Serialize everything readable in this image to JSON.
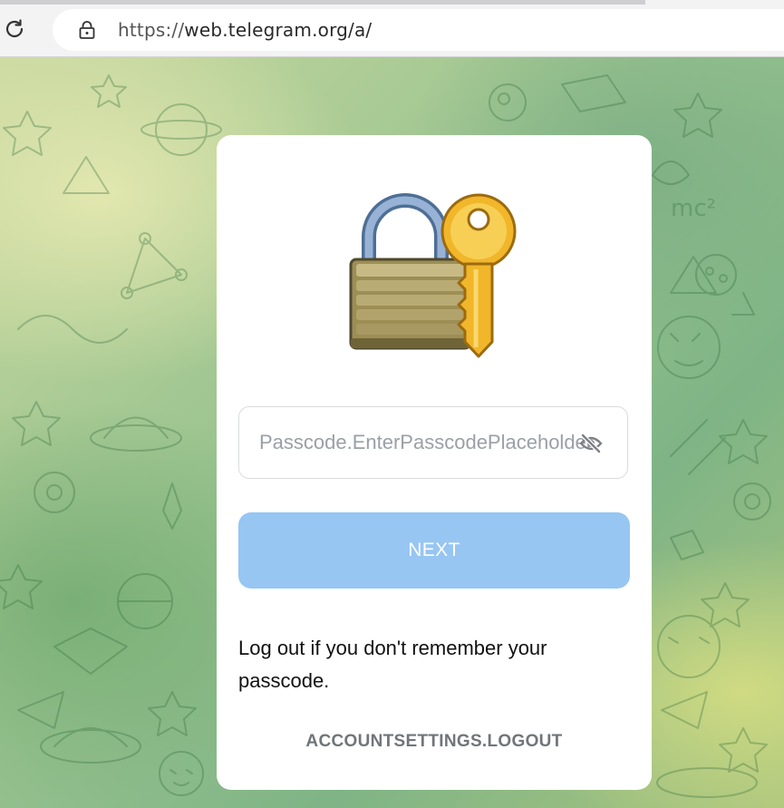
{
  "browser": {
    "url_scheme": "https://",
    "url_rest": "web.telegram.org/a/",
    "reload_icon": "reload-icon",
    "lock_icon": "padlock-icon"
  },
  "passcode_screen": {
    "illustration": "locked-with-key-emoji",
    "input_value": "",
    "input_placeholder": "Passcode.EnterPasscodePlaceholder",
    "toggle_icon": "eye-closed-icon",
    "next_label": "NEXT",
    "hint_text": "Log out if you don't remember your passcode.",
    "logout_label": "ACCOUNTSETTINGS.LOGOUT"
  },
  "colors": {
    "next_button": "#97c6f3",
    "logout_link": "#707579",
    "card": "#ffffff"
  }
}
